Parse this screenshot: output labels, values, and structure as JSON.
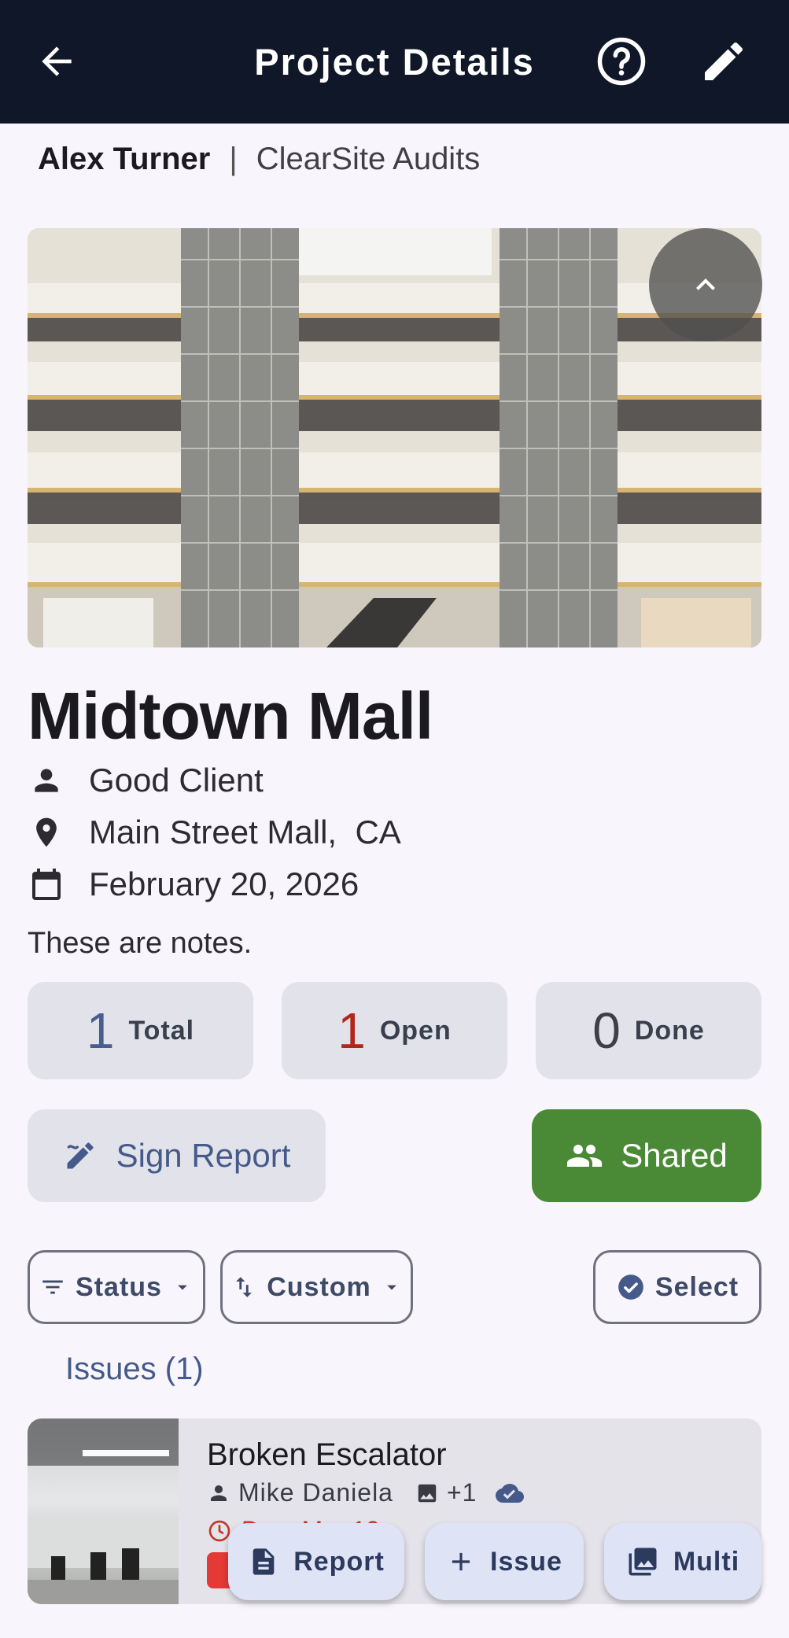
{
  "appbar": {
    "title": "Project Details"
  },
  "user": {
    "name": "Alex Turner",
    "separator": "|",
    "company": "ClearSite Audits"
  },
  "project": {
    "name": "Midtown Mall",
    "client": "Good Client",
    "location": "Main Street Mall,  CA",
    "date": "February 20, 2026",
    "notes": "These are notes."
  },
  "stats": [
    {
      "value": "1",
      "label": "Total",
      "color": "#4a5d8f"
    },
    {
      "value": "1",
      "label": "Open",
      "color": "#b3261e"
    },
    {
      "value": "0",
      "label": "Done",
      "color": "#3f4046"
    }
  ],
  "actions": {
    "sign_report": "Sign Report",
    "shared": "Shared"
  },
  "filters": {
    "status": "Status",
    "sort": "Custom",
    "select": "Select"
  },
  "issues": {
    "heading": "Issues (1)",
    "items": [
      {
        "title": "Broken Escalator",
        "assignee": "Mike Daniela",
        "photos_extra": "+1",
        "due": "Due: Mar 19"
      }
    ]
  },
  "fabs": {
    "report": "Report",
    "issue": "Issue",
    "multi": "Multi"
  },
  "colors": {
    "appbar": "#0f1729",
    "shared": "#4a8a36",
    "accent": "#455a8a",
    "overdue": "#e53935"
  }
}
